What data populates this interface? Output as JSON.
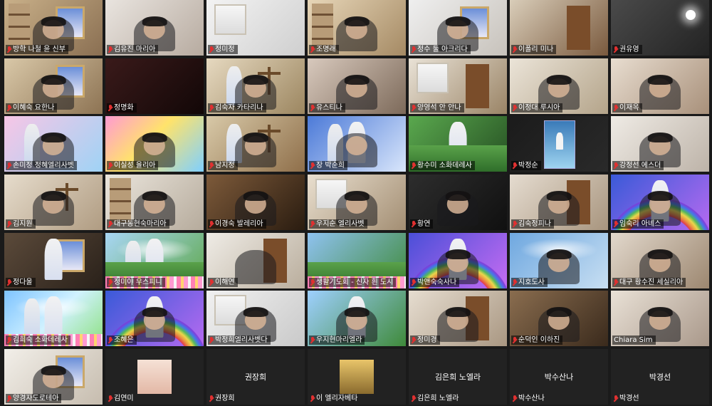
{
  "app": "Video conference gallery view",
  "participants": [
    {
      "name": "방학 나철 윤 신부",
      "muted": true,
      "bg": "linear-gradient(135deg,#c9b089,#8a6f52)",
      "decor": [
        "shelf",
        "picture",
        "silhouette",
        "head",
        "hair"
      ]
    },
    {
      "name": "김유진 마리아",
      "muted": true,
      "bg": "linear-gradient(135deg,#e9e4df,#b7aba0)",
      "decor": [
        "silhouette",
        "head",
        "hair"
      ]
    },
    {
      "name": "정미정",
      "muted": true,
      "bg": "linear-gradient(135deg,#f3f3f3,#cfcfcf)",
      "decor": [
        "window"
      ]
    },
    {
      "name": "조명래",
      "muted": true,
      "bg": "linear-gradient(135deg,#e7d6b8,#a58a64)",
      "decor": [
        "shelf",
        "silhouette",
        "head",
        "hair"
      ]
    },
    {
      "name": "정수 둘 아크리다",
      "muted": true,
      "bg": "linear-gradient(135deg,#efefef,#c7c2bb)",
      "decor": [
        "picture",
        "silhouette",
        "head",
        "hair"
      ]
    },
    {
      "name": "이폴리 미나",
      "muted": true,
      "bg": "linear-gradient(135deg,#d9cdb9,#7a5a3e)",
      "decor": [
        "door"
      ]
    },
    {
      "name": "권유영",
      "muted": true,
      "bg": "linear-gradient(135deg,#4a4a4a,#232323)",
      "decor": [
        "lamp"
      ]
    },
    {
      "name": "이혜숙 요한나",
      "muted": true,
      "bg": "linear-gradient(135deg,#d9c8a8,#8d7353)",
      "decor": [
        "picture",
        "silhouette",
        "head",
        "hair"
      ]
    },
    {
      "name": "정명화",
      "muted": true,
      "bg": "linear-gradient(135deg,#3a1a1a,#120707)",
      "decor": []
    },
    {
      "name": "김숙자 카타리나",
      "muted": true,
      "bg": "linear-gradient(135deg,#e6d9c0,#9c8660)",
      "decor": [
        "statue2",
        "cross",
        "silhouette",
        "head",
        "hair"
      ]
    },
    {
      "name": "유스티나",
      "muted": true,
      "bg": "linear-gradient(135deg,#d8c9bd,#7d6a5a)",
      "decor": [
        "silhouette",
        "head",
        "hair"
      ]
    },
    {
      "name": "양영석 안 안나",
      "muted": true,
      "bg": "linear-gradient(135deg,#e9e2d6,#9a8466)",
      "decor": [
        "door",
        "window"
      ]
    },
    {
      "name": "이정대 루시아",
      "muted": true,
      "bg": "linear-gradient(135deg,#ebe4d8,#b4a48a)",
      "decor": [
        "silhouette",
        "head",
        "hair"
      ]
    },
    {
      "name": "이재옥",
      "muted": true,
      "bg": "linear-gradient(135deg,#e8ddd0,#a8907a)",
      "decor": [
        "silhouette",
        "head",
        "hair"
      ]
    },
    {
      "name": "손미정 정혜엘리사벳",
      "muted": true,
      "bg": "linear-gradient(135deg,#f7c6e6,#9fd3f5)",
      "decor": [
        "statue2",
        "silhouette",
        "head",
        "hair"
      ]
    },
    {
      "name": "이실성 율리아",
      "muted": true,
      "bg": "linear-gradient(135deg,#ff9ad2,#ffe36b 45%,#7fd0ff)",
      "decor": [
        "silhouette",
        "head",
        "hair"
      ]
    },
    {
      "name": "남지정",
      "muted": true,
      "bg": "linear-gradient(135deg,#d8c9a8,#8f6f4a)",
      "decor": [
        "statue2",
        "cross",
        "silhouette",
        "head",
        "hair"
      ]
    },
    {
      "name": "장 박순희",
      "muted": true,
      "bg": "linear-gradient(135deg,#4c7ad8,#d9e6fb)",
      "decor": [
        "statue",
        "statue2",
        "silhouette",
        "head"
      ]
    },
    {
      "name": "황수미 소화데레사",
      "muted": true,
      "bg": "linear-gradient(135deg,#5aa84e,#254f22)",
      "decor": [
        "statue",
        "garden"
      ]
    },
    {
      "name": "박정순",
      "muted": true,
      "bg": "linear-gradient(135deg,#1b1b1b,#2a2a2a)",
      "decor": [
        "poster"
      ]
    },
    {
      "name": "강정선 에스더",
      "muted": true,
      "bg": "linear-gradient(135deg,#efebe5,#bdb3a8)",
      "decor": [
        "silhouette",
        "head",
        "hair"
      ]
    },
    {
      "name": "김지원",
      "muted": true,
      "bg": "linear-gradient(135deg,#e6dccc,#b09c82)",
      "decor": [
        "cross",
        "silhouette",
        "head",
        "hair"
      ]
    },
    {
      "name": "대구동현숙마리아",
      "muted": true,
      "bg": "linear-gradient(135deg,#ebe6dd,#b6ab9c)",
      "decor": [
        "shelf",
        "silhouette",
        "head",
        "hair"
      ]
    },
    {
      "name": "이경숙 발레리아",
      "muted": true,
      "bg": "linear-gradient(135deg,#7d5a3a,#2a1c10)",
      "decor": [
        "silhouette",
        "head",
        "hair"
      ]
    },
    {
      "name": "우지순 엘리사벳",
      "muted": true,
      "bg": "linear-gradient(135deg,#e9dfcf,#a38e73)",
      "decor": [
        "window",
        "silhouette",
        "head",
        "hair"
      ]
    },
    {
      "name": "황연",
      "muted": true,
      "bg": "linear-gradient(135deg,#2d2d2d,#101010)",
      "decor": [
        "silhouette",
        "head",
        "hair"
      ]
    },
    {
      "name": "김숙정피나",
      "muted": true,
      "bg": "linear-gradient(135deg,#e5dcd0,#a8957e)",
      "decor": [
        "door",
        "silhouette",
        "head",
        "hair"
      ]
    },
    {
      "name": "임숙리 아녜스",
      "muted": true,
      "bg": "linear-gradient(135deg,#3a5ad8,#b56af0)",
      "decor": [
        "rainbow",
        "statue",
        "silhouette",
        "head",
        "hair"
      ]
    },
    {
      "name": "정다울",
      "muted": true,
      "bg": "linear-gradient(135deg,#5b4a3a,#2a211a)",
      "decor": [
        "picture",
        "statue"
      ]
    },
    {
      "name": "정미야 우스피니",
      "muted": true,
      "bg": "linear-gradient(135deg,#a8d6f5,#5fa84c)",
      "decor": [
        "cloud",
        "statue",
        "statue2",
        "garden",
        "flowers"
      ]
    },
    {
      "name": "이해연",
      "muted": true,
      "bg": "linear-gradient(135deg,#efece6,#b9ad9c)",
      "decor": [
        "door",
        "silhouette"
      ]
    },
    {
      "name": "생활기도회 - 신자 흰 도시",
      "muted": true,
      "bg": "linear-gradient(135deg,#8fc2f0,#3f8a3a)",
      "decor": [
        "garden",
        "flowers"
      ]
    },
    {
      "name": "박앤숙숙사나",
      "muted": true,
      "bg": "linear-gradient(135deg,#4b4fd8,#c56cf2)",
      "decor": [
        "rainbow",
        "statue",
        "silhouette",
        "head",
        "hair"
      ]
    },
    {
      "name": "지호도사",
      "muted": true,
      "bg": "linear-gradient(135deg,#6fa8e0,#c8dff2)",
      "decor": [
        "cloud",
        "silhouette",
        "head",
        "hair"
      ]
    },
    {
      "name": "대구 황수진 세실리아",
      "muted": true,
      "bg": "linear-gradient(135deg,#e2d8cc,#9c8770)",
      "decor": [
        "silhouette",
        "head",
        "hair"
      ]
    },
    {
      "name": "김희숙 소화데레사",
      "muted": true,
      "bg": "linear-gradient(135deg,#7ec3ff,#d1f2ff 50%,#8be07e)",
      "decor": [
        "cloud",
        "statue",
        "statue2",
        "flowers"
      ]
    },
    {
      "name": "조혜은",
      "muted": true,
      "bg": "linear-gradient(135deg,#3a5ad8,#b56af0)",
      "decor": [
        "rainbow",
        "statue",
        "silhouette",
        "head",
        "hair"
      ]
    },
    {
      "name": "박정희엘리사벳다",
      "muted": true,
      "bg": "linear-gradient(135deg,#f1f1f1,#c9c9c9)",
      "decor": [
        "window",
        "silhouette",
        "head",
        "hair"
      ]
    },
    {
      "name": "우지현마리엘라",
      "muted": true,
      "bg": "linear-gradient(135deg,#9ed0ff,#3f8a3a)",
      "decor": [
        "statue",
        "silhouette",
        "head",
        "hair"
      ]
    },
    {
      "name": "정미경",
      "muted": true,
      "bg": "linear-gradient(135deg,#e6ddd0,#a99782)",
      "decor": [
        "door",
        "silhouette",
        "head",
        "hair"
      ]
    },
    {
      "name": "순덕인 이하진",
      "muted": true,
      "bg": "linear-gradient(135deg,#8a6d4f,#3a2a1c)",
      "decor": [
        "silhouette",
        "head",
        "hair"
      ]
    },
    {
      "name": "Chiara Sim",
      "muted": false,
      "bg": "linear-gradient(135deg,#e9e1d6,#a9988a)",
      "decor": [
        "silhouette",
        "head",
        "hair"
      ]
    },
    {
      "name": "양경자도로테아",
      "muted": true,
      "bg": "linear-gradient(135deg,#f2efe9,#c6bcae)",
      "decor": [
        "picture",
        "silhouette",
        "head",
        "hair"
      ]
    },
    {
      "name": "김연미",
      "muted": true,
      "blank": true,
      "photo": "linear-gradient(180deg,#f5e1d6,#e3b8a6)",
      "center": ""
    },
    {
      "name": "권장희",
      "muted": true,
      "blank": true,
      "center": "권장희"
    },
    {
      "name": "이 엘리자베타",
      "muted": true,
      "blank": true,
      "photo": "linear-gradient(180deg,#e9c56a,#8a6b2e)",
      "center": ""
    },
    {
      "name": "김은희 노엘라",
      "muted": true,
      "blank": true,
      "center": "김은희 노엘라"
    },
    {
      "name": "박수산나",
      "muted": true,
      "blank": true,
      "center": "박수산나"
    },
    {
      "name": "박경선",
      "muted": true,
      "blank": true,
      "center": "박경선"
    }
  ]
}
